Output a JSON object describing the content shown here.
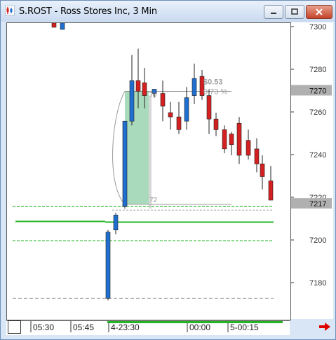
{
  "window": {
    "title": "S.ROST - Ross Stores Inc, 3 Min",
    "controls": [
      "minimize",
      "maximize",
      "close"
    ]
  },
  "price_axis": {
    "ticks": [
      "7300",
      "7280",
      "7260",
      "7240",
      "7220",
      "7200",
      "7180"
    ],
    "current_price_label": "7270",
    "marker_price_label": "7217"
  },
  "time_axis": {
    "labels": [
      "05:30",
      "05:45",
      "4-23:30",
      "00:00",
      "5-00:15"
    ]
  },
  "annotations": {
    "change_amount": "$0.53",
    "change_percent": "0.73 %",
    "low_label": "72",
    "high_label": "70"
  },
  "colors": {
    "up_candle": "#1f6fd1",
    "down_candle": "#d42020",
    "green_line": "#22b422",
    "green_fill": "#9ad4b0",
    "price_box": "#b0b0b0",
    "arrow": "#e00000"
  },
  "chart_data": {
    "type": "candlestick",
    "y_range": [
      7172,
      7304
    ],
    "y_ticks": [
      7180,
      7200,
      7220,
      7240,
      7260,
      7280,
      7300
    ],
    "x_labels": [
      "05:30",
      "05:45",
      "4-23:30",
      "00:00",
      "5-00:15"
    ],
    "candles": [
      {
        "o": 7302,
        "h": 7303,
        "l": 7300,
        "c": 7300
      },
      {
        "o": 7299,
        "h": 7302,
        "l": 7299,
        "c": 7302
      },
      {
        "o": 7173,
        "h": 7205,
        "l": 7172,
        "c": 7204
      },
      {
        "o": 7205,
        "h": 7213,
        "l": 7203,
        "c": 7212
      },
      {
        "o": 7216,
        "h": 7241,
        "l": 7215,
        "c": 7256
      },
      {
        "o": 7256,
        "h": 7287,
        "l": 7254,
        "c": 7275
      },
      {
        "o": 7275,
        "h": 7290,
        "l": 7262,
        "c": 7270
      },
      {
        "o": 7274,
        "h": 7281,
        "l": 7262,
        "c": 7268
      },
      {
        "o": 7269,
        "h": 7271,
        "l": 7267,
        "c": 7271
      },
      {
        "o": 7269,
        "h": 7275,
        "l": 7256,
        "c": 7263
      },
      {
        "o": 7260,
        "h": 7265,
        "l": 7252,
        "c": 7258
      },
      {
        "o": 7258,
        "h": 7265,
        "l": 7250,
        "c": 7252
      },
      {
        "o": 7256,
        "h": 7272,
        "l": 7252,
        "c": 7267
      },
      {
        "o": 7268,
        "h": 7283,
        "l": 7264,
        "c": 7276
      },
      {
        "o": 7277,
        "h": 7280,
        "l": 7266,
        "c": 7268
      },
      {
        "o": 7268,
        "h": 7271,
        "l": 7250,
        "c": 7257
      },
      {
        "o": 7257,
        "h": 7260,
        "l": 7249,
        "c": 7252
      },
      {
        "o": 7252,
        "h": 7254,
        "l": 7241,
        "c": 7243
      },
      {
        "o": 7250,
        "h": 7251,
        "l": 7240,
        "c": 7245
      },
      {
        "o": 7255,
        "h": 7258,
        "l": 7236,
        "c": 7240
      },
      {
        "o": 7247,
        "h": 7252,
        "l": 7238,
        "c": 7240
      },
      {
        "o": 7243,
        "h": 7248,
        "l": 7232,
        "c": 7236
      },
      {
        "o": 7236,
        "h": 7240,
        "l": 7224,
        "c": 7230
      },
      {
        "o": 7228,
        "h": 7235,
        "l": 7220,
        "c": 7219
      }
    ],
    "levels": {
      "dashed_upper": 7216,
      "solid_green": 7209,
      "dashed_lower": 7200,
      "bottom_dashed": 7173,
      "entry_high": 7270,
      "entry_low": 7217
    },
    "grid": false
  }
}
